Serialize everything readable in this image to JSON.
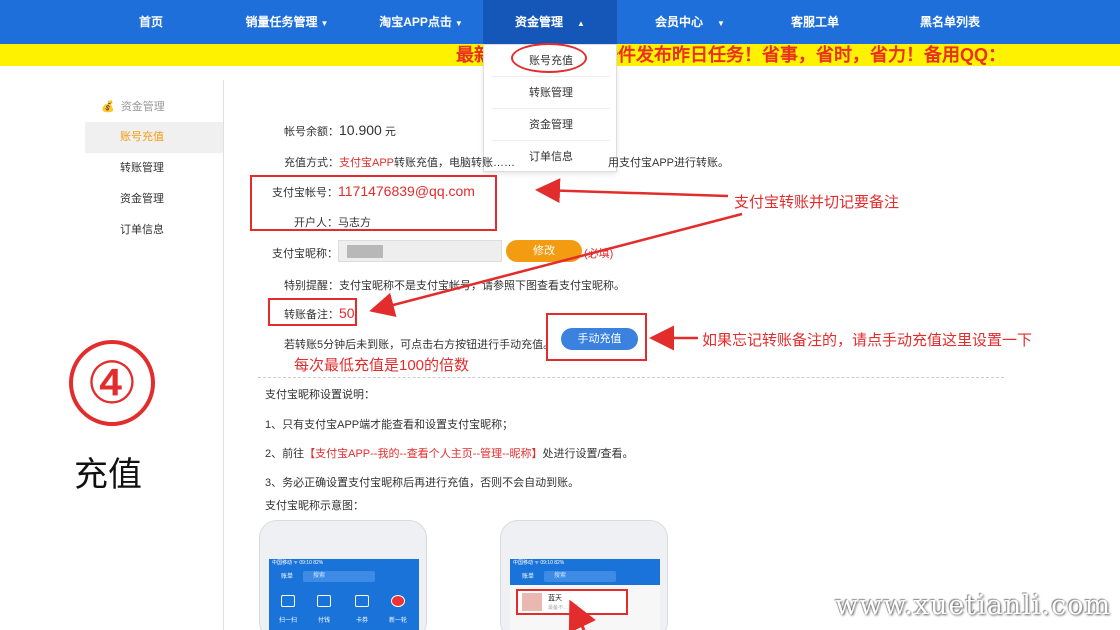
{
  "nav": {
    "items": [
      {
        "label": "首页"
      },
      {
        "label": "销量任务管理"
      },
      {
        "label": "淘宝APP点击"
      },
      {
        "label": "资金管理"
      },
      {
        "label": "会员中心"
      },
      {
        "label": "客服工单"
      },
      {
        "label": "黑名单列表"
      }
    ],
    "active_color": "#1557b8",
    "bar_color": "#1e6fd9"
  },
  "marquee": {
    "text": "最新……制任务，一件发布昨日任务！省事，省时，省力！备用QQ："
  },
  "dropdown": {
    "items": [
      "账号充值",
      "转账管理",
      "资金管理",
      "订单信息"
    ]
  },
  "sidebar": {
    "heading": "资金管理",
    "heading_icon": "money-bag-icon",
    "items": [
      "账号充值",
      "转账管理",
      "资金管理",
      "订单信息"
    ]
  },
  "left_label": {
    "number": "④",
    "title": "充值"
  },
  "form": {
    "balance_label": "帐号余额：",
    "balance_value": "10.900",
    "balance_unit": "元",
    "method_label": "充值方式：",
    "method_value": "支付宝APP",
    "method_rest": "转账充值，电脑转账……",
    "method_tail": "用支付宝APP进行转账。",
    "account_label": "支付宝帐号：",
    "account_value": "1171476839@qq.com",
    "holder_label": "开户人：",
    "holder_value": "马志方",
    "nick_label": "支付宝昵称：",
    "edit_button": "修改",
    "required": "(必填)",
    "notice": "特别提醒：支付宝昵称不是支付宝帐号，请参照下图查看支付宝昵称。",
    "remark_label": "转账备注：",
    "remark_value": "50",
    "manual_hint": "若转账5分钟后未到账，可点击右方按钮进行手动充值。",
    "manual_button": "手动充值",
    "min_hint": "每次最低充值是100的倍数"
  },
  "annotations": {
    "transfer_note": "支付宝转账并切记要备注",
    "manual_note": "如果忘记转账备注的，请点手动充值这里设置一下"
  },
  "instructions": {
    "heading": "支付宝昵称设置说明：",
    "line1": "1、只有支付宝APP端才能查看和设置支付宝昵称；",
    "line2_prefix": "2、前往",
    "line2_red": "【支付宝APP--我的--查看个人主页--管理--昵称】",
    "line2_suffix": "处进行设置/查看。",
    "line3": "3、务必正确设置支付宝昵称后再进行充值，否则不会自动到账。",
    "diagram_label": "支付宝昵称示意图："
  },
  "phones": {
    "status": "中国移动 ᯤ        09:10        82%",
    "search_placeholder": "搜索",
    "bar_label": "账单",
    "icons": [
      "扫一扫",
      "付钱",
      "卡券",
      "新一轮"
    ],
    "profile_name": "蓝天",
    "profile_sub": "最备不…主页"
  },
  "watermark": "www.xuetianli.com"
}
